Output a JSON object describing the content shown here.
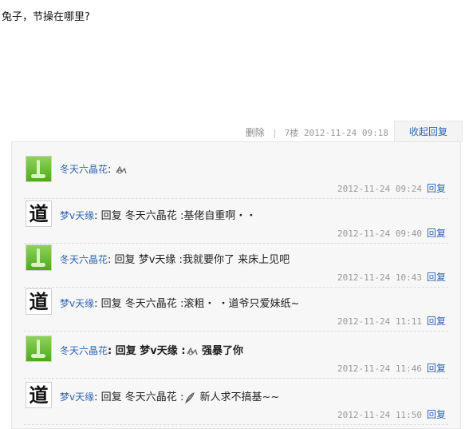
{
  "post": {
    "text": "兔子，节操在哪里?",
    "delete_label": "删除",
    "separator": "|",
    "floor": "7楼",
    "datetime": "2012-11-24 09:18",
    "collapse_label": "收起回复"
  },
  "reply_label": "回复",
  "replies": [
    {
      "user": "冬天六晶花",
      "avatar": "green-plant",
      "prefix": "",
      "target": "",
      "colon": ":",
      "text": "",
      "emoticon": "doodle-emoticon",
      "datetime": "2012-11-24 09:24"
    },
    {
      "user": "梦v天缘",
      "avatar": "dao-character",
      "avatar_text": "道",
      "prefix": "回复",
      "target": "冬天六晶花",
      "colon": ":",
      "text": "基佬自重啊・・",
      "emoticon": "",
      "datetime": "2012-11-24 09:40"
    },
    {
      "user": "冬天六晶花",
      "avatar": "green-plant",
      "prefix": "回复",
      "target": "梦v天缘",
      "colon": ":",
      "text": "我就要你了 来床上见吧",
      "emoticon": "",
      "datetime": "2012-11-24 10:43"
    },
    {
      "user": "梦v天缘",
      "avatar": "dao-character",
      "avatar_text": "道",
      "prefix": "回复",
      "target": "冬天六晶花",
      "colon": ":",
      "text": "滚粗・ ・道爷只爱妹纸~",
      "emoticon": "",
      "datetime": "2012-11-24 11:11"
    },
    {
      "user": "冬天六晶花",
      "avatar": "green-plant",
      "prefix": "回复",
      "target": "梦v天缘",
      "colon": ":",
      "text": "强暴了你",
      "emoticon": "doodle-emoticon",
      "datetime": "2012-11-24 11:46"
    },
    {
      "user": "梦v天缘",
      "avatar": "dao-character",
      "avatar_text": "道",
      "prefix": "回复",
      "target": "冬天六晶花",
      "colon": ":",
      "text": "新人求不搞基~~",
      "emoticon": "feather-emoticon",
      "datetime": "2012-11-24 11:50"
    }
  ]
}
